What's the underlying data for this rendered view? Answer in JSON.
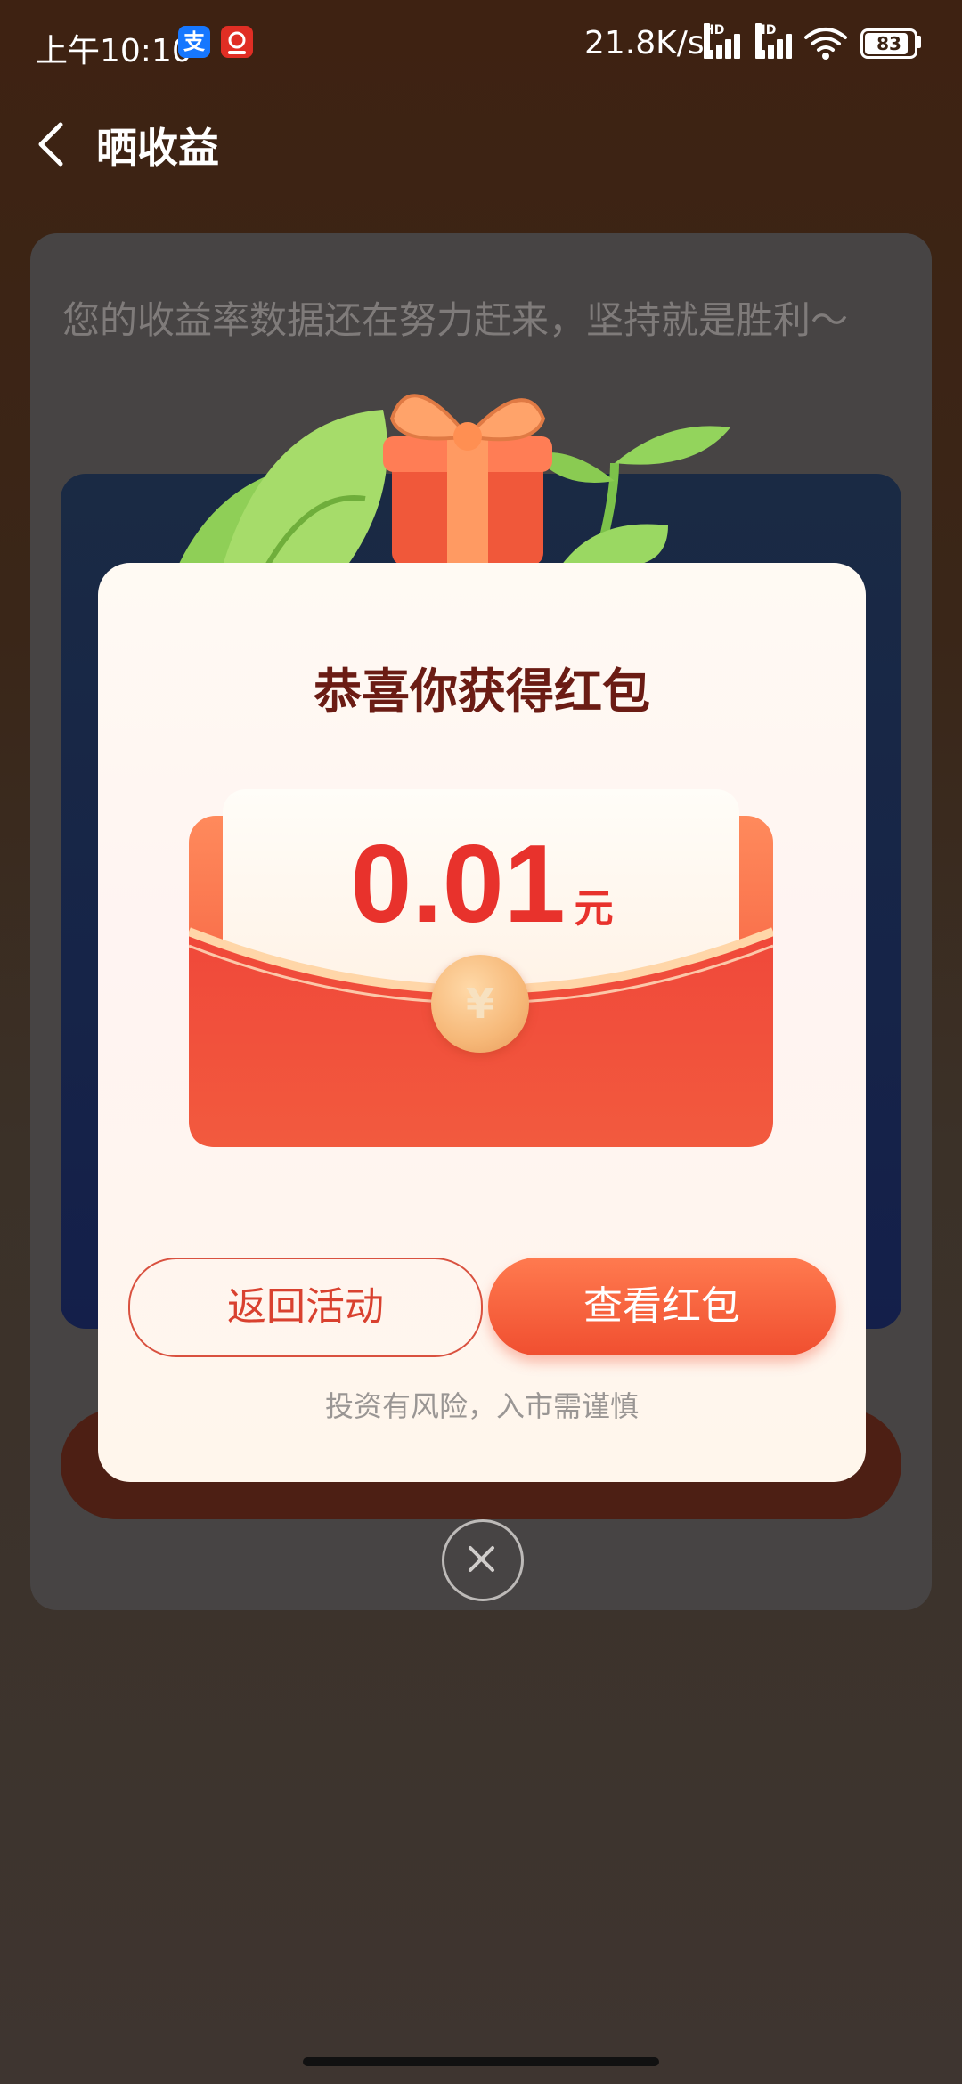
{
  "status_bar": {
    "time": "上午10:10",
    "alipay_icon_glyph": "支",
    "net_speed": "21.8K/s",
    "hd_label": "HD",
    "battery": "83"
  },
  "header": {
    "title": "晒收益"
  },
  "background": {
    "message": "您的收益率数据还在努力赶来，坚持就是胜利～"
  },
  "modal": {
    "title": "恭喜你获得红包",
    "amount": "0.01",
    "unit": "元",
    "coin_glyph": "¥",
    "back_button": "返回活动",
    "view_button": "查看红包",
    "risk_note": "投资有风险，入市需谨慎"
  },
  "icons": {
    "back": "chevron-left-icon",
    "close": "close-icon",
    "wifi": "wifi-icon",
    "signal": "signal-icon"
  },
  "colors": {
    "accent": "#e8322c",
    "button_gradient_start": "#ff7a4f",
    "button_gradient_end": "#f04f30",
    "title_color": "#6b1c14"
  }
}
